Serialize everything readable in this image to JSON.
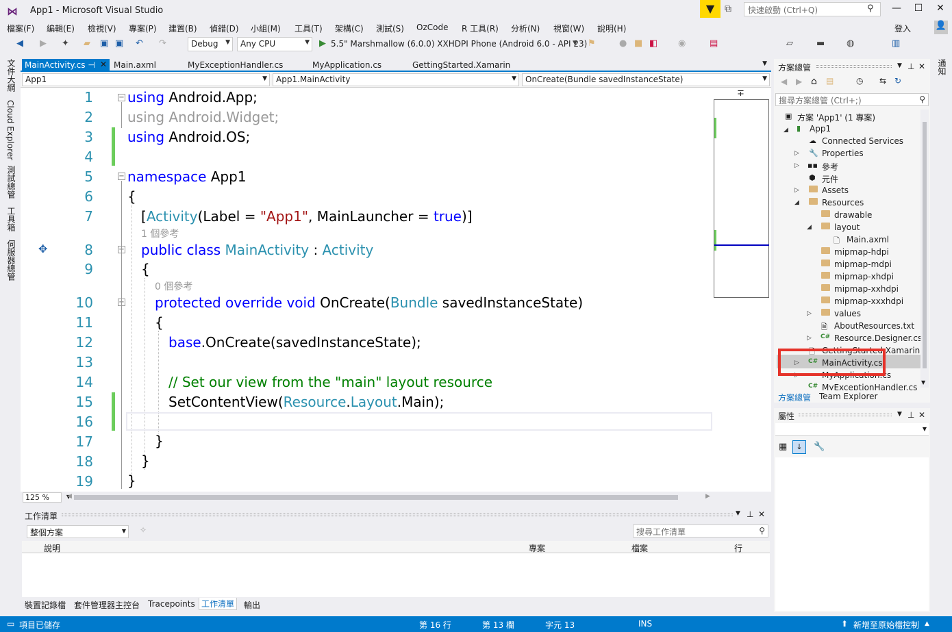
{
  "window": {
    "title": "App1 - Microsoft Visual Studio",
    "quick_launch_placeholder": "快速啟動 (Ctrl+Q)",
    "login": "登入"
  },
  "menu": [
    "檔案(F)",
    "編輯(E)",
    "檢視(V)",
    "專案(P)",
    "建置(B)",
    "偵錯(D)",
    "小組(M)",
    "工具(T)",
    "架構(C)",
    "測試(S)",
    "OzCode",
    "R 工具(R)",
    "分析(N)",
    "視窗(W)",
    "說明(H)"
  ],
  "toolbar": {
    "config": "Debug",
    "platform": "Any CPU",
    "run_target": "5.5\" Marshmallow (6.0.0) XXHDPI Phone (Android 6.0 - API 23)"
  },
  "left_tabs": [
    "文件大綱",
    "Cloud Explorer",
    "測試總管",
    "工具箱",
    "伺服器總管"
  ],
  "doc_tabs": [
    "MainActivity.cs",
    "Main.axml",
    "MyExceptionHandler.cs",
    "MyApplication.cs",
    "GettingStarted.Xamarin"
  ],
  "nav": {
    "project": "App1",
    "type": "App1.MainActivity",
    "member": "OnCreate(Bundle savedInstanceState)"
  },
  "code": {
    "line_numbers": [
      "1",
      "2",
      "3",
      "4",
      "5",
      "6",
      "7",
      "8",
      "9",
      "10",
      "11",
      "12",
      "13",
      "14",
      "15",
      "16",
      "17",
      "18",
      "19"
    ],
    "l1_kw": "using",
    "l1_rest": " Android.App;",
    "l2": "using Android.Widget;",
    "l3_kw": "using",
    "l3_rest": " Android.OS;",
    "l5_kw": "namespace",
    "l5_rest": " App1",
    "l6": "{",
    "l7_a": "[",
    "l7_ty": "Activity",
    "l7_b": "(Label = ",
    "l7_str": "\"App1\"",
    "l7_c": ", MainLauncher = ",
    "l7_true": "true",
    "l7_d": ")]",
    "cl1": "1 個參考",
    "l8_kw": "public class",
    "l8_sp": " ",
    "l8_ty": "MainActivity",
    "l8_colon": " : ",
    "l8_base": "Activity",
    "l9": "{",
    "cl2": "0 個參考",
    "l10_kw": "protected override void",
    "l10_a": " OnCreate(",
    "l10_ty": "Bundle",
    "l10_b": " savedInstanceState)",
    "l11": "{",
    "l12_kw": "base",
    "l12_rest": ".OnCreate(savedInstanceState);",
    "l14": "// Set our view from the \"main\" layout resource",
    "l15_a": "SetContentView(",
    "l15_t1": "Resource",
    "l15_dot1": ".",
    "l15_t2": "Layout",
    "l15_b": ".Main);",
    "l17": "}",
    "l18": "}",
    "l19": "}"
  },
  "zoom": "125 %",
  "task_list": {
    "title": "工作清單",
    "scope": "整個方案",
    "search_placeholder": "搜尋工作清單",
    "columns": [
      "說明",
      "專案",
      "檔案",
      "行"
    ]
  },
  "bottom_tabs": [
    "裝置記錄檔",
    "套件管理器主控台",
    "Tracepoints",
    "工作清單",
    "輸出"
  ],
  "solution_explorer": {
    "title": "方案總管",
    "search_placeholder": "搜尋方案總管 (Ctrl+;)",
    "items": [
      "方案 'App1' (1 專案)",
      "App1",
      "Connected Services",
      "Properties",
      "參考",
      "元件",
      "Assets",
      "Resources",
      "drawable",
      "layout",
      "Main.axml",
      "mipmap-hdpi",
      "mipmap-mdpi",
      "mipmap-xhdpi",
      "mipmap-xxhdpi",
      "mipmap-xxxhdpi",
      "values",
      "AboutResources.txt",
      "Resource.Designer.cs",
      "GettingStarted.Xamarin",
      "MainActivity.cs",
      "MyApplication.cs",
      "MyExceptionHandler.cs"
    ],
    "tabs": [
      "方案總管",
      "Team Explorer"
    ],
    "highlight_color": "#e5332a"
  },
  "properties": {
    "title": "屬性"
  },
  "status": {
    "saved": "項目已儲存",
    "line": "第 16 行",
    "col": "第 13 欄",
    "char": "字元 13",
    "ins": "INS",
    "source_control": "新增至原始檔控制"
  },
  "colors": {
    "accent": "#007acc",
    "keyword": "#0000ff",
    "type": "#2b91af",
    "string": "#a31515",
    "comment": "#008000"
  }
}
